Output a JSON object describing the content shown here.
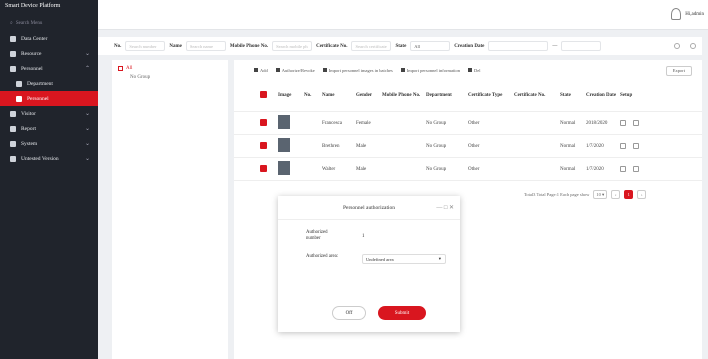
{
  "brand": "Smart Device Platform",
  "sidebar": {
    "search_placeholder": "Search Menu",
    "items": [
      {
        "label": "Data Center",
        "icon": "monitor-icon",
        "chevron": ""
      },
      {
        "label": "Resource",
        "icon": "pin-icon",
        "chevron": "⌄"
      },
      {
        "label": "Personnel",
        "icon": "people-icon",
        "chevron": "⌃"
      },
      {
        "label": "Department",
        "icon": "org-icon",
        "chevron": ""
      },
      {
        "label": "Personnel",
        "icon": "person-icon",
        "chevron": ""
      },
      {
        "label": "Visitor",
        "icon": "visitor-icon",
        "chevron": "⌄"
      },
      {
        "label": "Report",
        "icon": "report-icon",
        "chevron": "⌄"
      },
      {
        "label": "System",
        "icon": "system-icon",
        "chevron": "⌄"
      },
      {
        "label": "Untested Version",
        "icon": "version-icon",
        "chevron": "⌄"
      }
    ]
  },
  "topbar": {
    "user": "Hi,admin"
  },
  "filter": {
    "no_label": "No.",
    "no_placeholder": "Search number",
    "name_label": "Name",
    "name_placeholder": "Search name",
    "phone_label": "Mobile Phone No.",
    "phone_placeholder": "Search mobile ph",
    "cert_label": "Certificate No.",
    "cert_placeholder": "Search certificate",
    "state_label": "State",
    "state_value": "All",
    "date_label": "Creation Date",
    "date_sep": "—"
  },
  "tree": {
    "root": "All",
    "child": "No Group"
  },
  "toolbar": {
    "add": "Add",
    "auth": "Authorize/Revoke",
    "import_pictures": "Import personnel images in batches",
    "import_info": "Import personnel information",
    "del": "Del",
    "export": "Export"
  },
  "table": {
    "headers": [
      "Image",
      "No.",
      "Name",
      "Gender",
      "Mobile Phone No.",
      "Department",
      "Certificate Type",
      "Certificate No.",
      "State",
      "Creation Date",
      "Setup"
    ],
    "rows": [
      {
        "no": "",
        "name": "Francesca",
        "gender": "Female",
        "phone": "",
        "dept": "No Group",
        "ctype": "Other",
        "cno": "",
        "state": "Normal",
        "date": "2018/2020"
      },
      {
        "no": "",
        "name": "Brethren",
        "gender": "Male",
        "phone": "",
        "dept": "No Group",
        "ctype": "Other",
        "cno": "",
        "state": "Normal",
        "date": "1/7/2020"
      },
      {
        "no": "",
        "name": "Walter",
        "gender": "Male",
        "phone": "",
        "dept": "No Group",
        "ctype": "Other",
        "cno": "",
        "state": "Normal",
        "date": "1/7/2020"
      }
    ]
  },
  "pager": {
    "summary": "Total3 Total Page:1 Each page show",
    "page_size": "10 ▾",
    "prev": "‹",
    "current": "1",
    "next": "›"
  },
  "modal": {
    "title": "Personnel authorization",
    "ctrl": "— □ ✕",
    "authorized_number_label": "Authorized number",
    "authorized_number_value": "1",
    "authorized_area_label": "Authorized area:",
    "authorized_area_value": "Undefined area",
    "off": "Off",
    "submit": "Submit"
  },
  "colors": {
    "accent": "#d9161f",
    "sidebar": "#20242c"
  }
}
